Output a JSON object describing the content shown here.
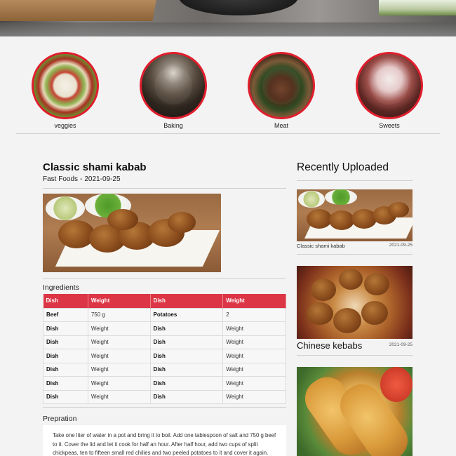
{
  "categories": [
    {
      "label": "veggies"
    },
    {
      "label": "Baking"
    },
    {
      "label": "Meat"
    },
    {
      "label": "Sweets"
    }
  ],
  "post": {
    "title": "Classic shami kabab",
    "category": "Fast Foods",
    "separator": "-",
    "date": "2021-09-25"
  },
  "ingredients": {
    "heading": "Ingredients",
    "columns": [
      "Dish",
      "Weight",
      "Dish",
      "Weight"
    ],
    "rows": [
      [
        "Beef",
        "750 g",
        "Potatoes",
        "2"
      ],
      [
        "Dish",
        "Weight",
        "Dish",
        "Weight"
      ],
      [
        "Dish",
        "Weight",
        "Dish",
        "Weight"
      ],
      [
        "Dish",
        "Weight",
        "Dish",
        "Weight"
      ],
      [
        "Dish",
        "Weight",
        "Dish",
        "Weight"
      ],
      [
        "Dish",
        "Weight",
        "Dish",
        "Weight"
      ],
      [
        "Dish",
        "Weight",
        "Dish",
        "Weight"
      ]
    ]
  },
  "preparation": {
    "heading": "Prepration",
    "text": "Take one liter of water in a pot and bring it to boil. Add one tablespoon of salt and 750 g beef to it. Cover the lid and let it cook for half an hour. After half hour, add two cups of split chickpeas, ten to fifteen small red chilies and two peeled potatoes to it and cover it again. Let"
  },
  "sidebar": {
    "title": "Recently Uploaded",
    "items": [
      {
        "title": "Classic shami kabab",
        "date": "2021-09-25"
      },
      {
        "title": "Chinese kebabs",
        "date": "2021-09-25"
      },
      {
        "title": "",
        "date": ""
      }
    ]
  },
  "colors": {
    "accent": "#dc3545",
    "circle_border": "#e01e2d"
  }
}
